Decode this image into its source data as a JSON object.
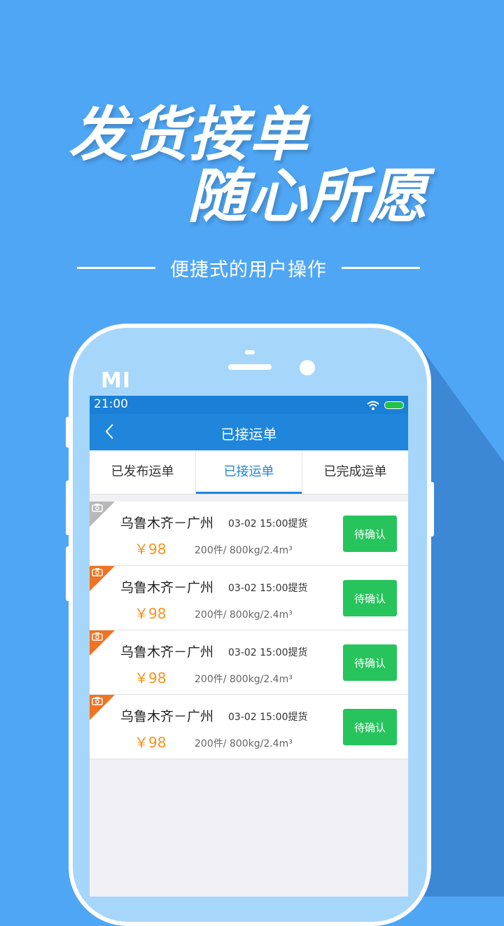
{
  "promo": {
    "headline_line1": "发货接单",
    "headline_line2": "随心所愿",
    "tagline": "便捷式的用户操作"
  },
  "device": {
    "brand": "MI"
  },
  "status_bar": {
    "time": "21:00"
  },
  "nav": {
    "title": "已接运单",
    "back_icon": "chevron-left-icon"
  },
  "tabs": [
    {
      "label": "已发布运单",
      "active": false
    },
    {
      "label": "已接运单",
      "active": true
    },
    {
      "label": "已完成运单",
      "active": false
    }
  ],
  "orders": [
    {
      "route": "乌鲁木齐－广州",
      "pickup": "03-02 15:00提货",
      "price": "￥98",
      "spec": "200件/ 800kg/2.4m³",
      "action": "待确认",
      "badge_color": "#b8b8b8"
    },
    {
      "route": "乌鲁木齐－广州",
      "pickup": "03-02 15:00提货",
      "price": "￥98",
      "spec": "200件/ 800kg/2.4m³",
      "action": "待确认",
      "badge_color": "#f07322"
    },
    {
      "route": "乌鲁木齐－广州",
      "pickup": "03-02 15:00提货",
      "price": "￥98",
      "spec": "200件/ 800kg/2.4m³",
      "action": "待确认",
      "badge_color": "#f07322"
    },
    {
      "route": "乌鲁木齐－广州",
      "pickup": "03-02 15:00提货",
      "price": "￥98",
      "spec": "200件/ 800kg/2.4m³",
      "action": "待确认",
      "badge_color": "#f07322"
    }
  ],
  "colors": {
    "background": "#4fa6f5",
    "nav": "#1f86dc",
    "confirm": "#27c45e",
    "price": "#f7931e"
  }
}
